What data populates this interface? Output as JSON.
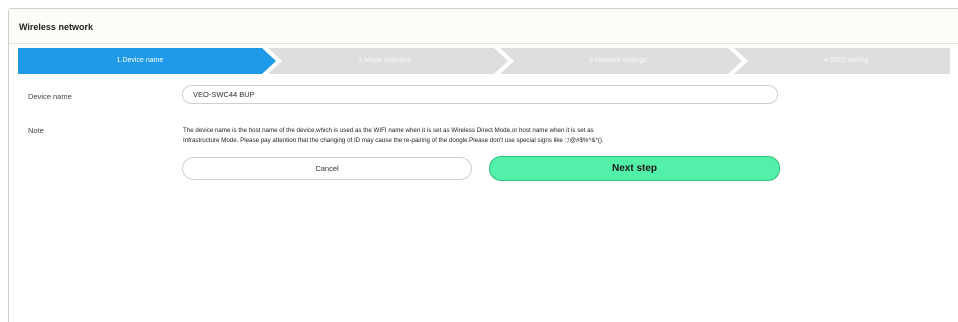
{
  "header": {
    "title": "Wireless network"
  },
  "steps": [
    {
      "label": "1.Device name",
      "active": true
    },
    {
      "label": "2.Mode selection",
      "active": false
    },
    {
      "label": "3.Network settings",
      "active": false
    },
    {
      "label": "4.SSID setting",
      "active": false
    }
  ],
  "form": {
    "device_name_label": "Device name",
    "device_name_value": "VEO-SWC44 BUP",
    "note_label": "Note",
    "note_line1": "The device name is the host name of the device,which is used as the WIFI name when it is set as Wireless Direct Mode,or host name when it is set as",
    "note_line2": "Infrastructure Mode. Please pay attention that the changing of ID may cause the re-pairing of the dongle.Please don't use special signs like :;!@#$%^&*()."
  },
  "buttons": {
    "cancel_label": "Cancel",
    "next_label": "Next step"
  },
  "colors": {
    "step_active": "#1f9ae8",
    "step_inactive": "#dedede",
    "next_button": "#52f0a8"
  }
}
